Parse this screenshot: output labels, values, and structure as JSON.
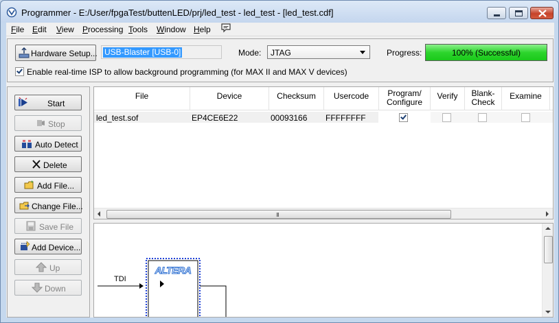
{
  "window": {
    "title": "Programmer - E:/User/fpgaTest/buttenLED/prj/led_test - led_test - [led_test.cdf]"
  },
  "menu": [
    "File",
    "Edit",
    "View",
    "Processing",
    "Tools",
    "Window",
    "Help"
  ],
  "hardware": {
    "setup_label": "Hardware Setup...",
    "device": "USB-Blaster [USB-0]",
    "mode_label": "Mode:",
    "mode_value": "JTAG",
    "progress_label": "Progress:",
    "progress_value": 100,
    "progress_text": "100% (Successful)",
    "progress_color": "#2dd52d"
  },
  "isp": {
    "checked": true,
    "label": "Enable real-time ISP to allow background programming (for MAX II and MAX V devices)"
  },
  "side_buttons": [
    {
      "label": "Start",
      "icon": "start-icon",
      "enabled": true
    },
    {
      "label": "Stop",
      "icon": "stop-icon",
      "enabled": false
    },
    {
      "label": "Auto Detect",
      "icon": "auto-detect-icon",
      "enabled": true
    },
    {
      "label": "Delete",
      "icon": "delete-icon",
      "enabled": true
    },
    {
      "label": "Add File...",
      "icon": "add-file-icon",
      "enabled": true
    },
    {
      "label": "Change File...",
      "icon": "change-file-icon",
      "enabled": true
    },
    {
      "label": "Save File",
      "icon": "save-file-icon",
      "enabled": false
    },
    {
      "label": "Add Device...",
      "icon": "add-device-icon",
      "enabled": true
    },
    {
      "label": "Up",
      "icon": "up-arrow-icon",
      "enabled": false
    },
    {
      "label": "Down",
      "icon": "down-arrow-icon",
      "enabled": false
    }
  ],
  "table": {
    "columns": [
      "File",
      "Device",
      "Checksum",
      "Usercode",
      "Program/\nConfigure",
      "Verify",
      "Blank-\nCheck",
      "Examine"
    ],
    "rows": [
      {
        "file": "led_test.sof",
        "device": "EP4CE6E22",
        "checksum": "00093166",
        "usercode": "FFFFFFFF",
        "program_configure": true,
        "verify": false,
        "blank_check": false,
        "examine": false
      }
    ],
    "scroll_grip": "III"
  },
  "diagram": {
    "input_label": "TDI",
    "chip_logo": "ALTERA"
  }
}
